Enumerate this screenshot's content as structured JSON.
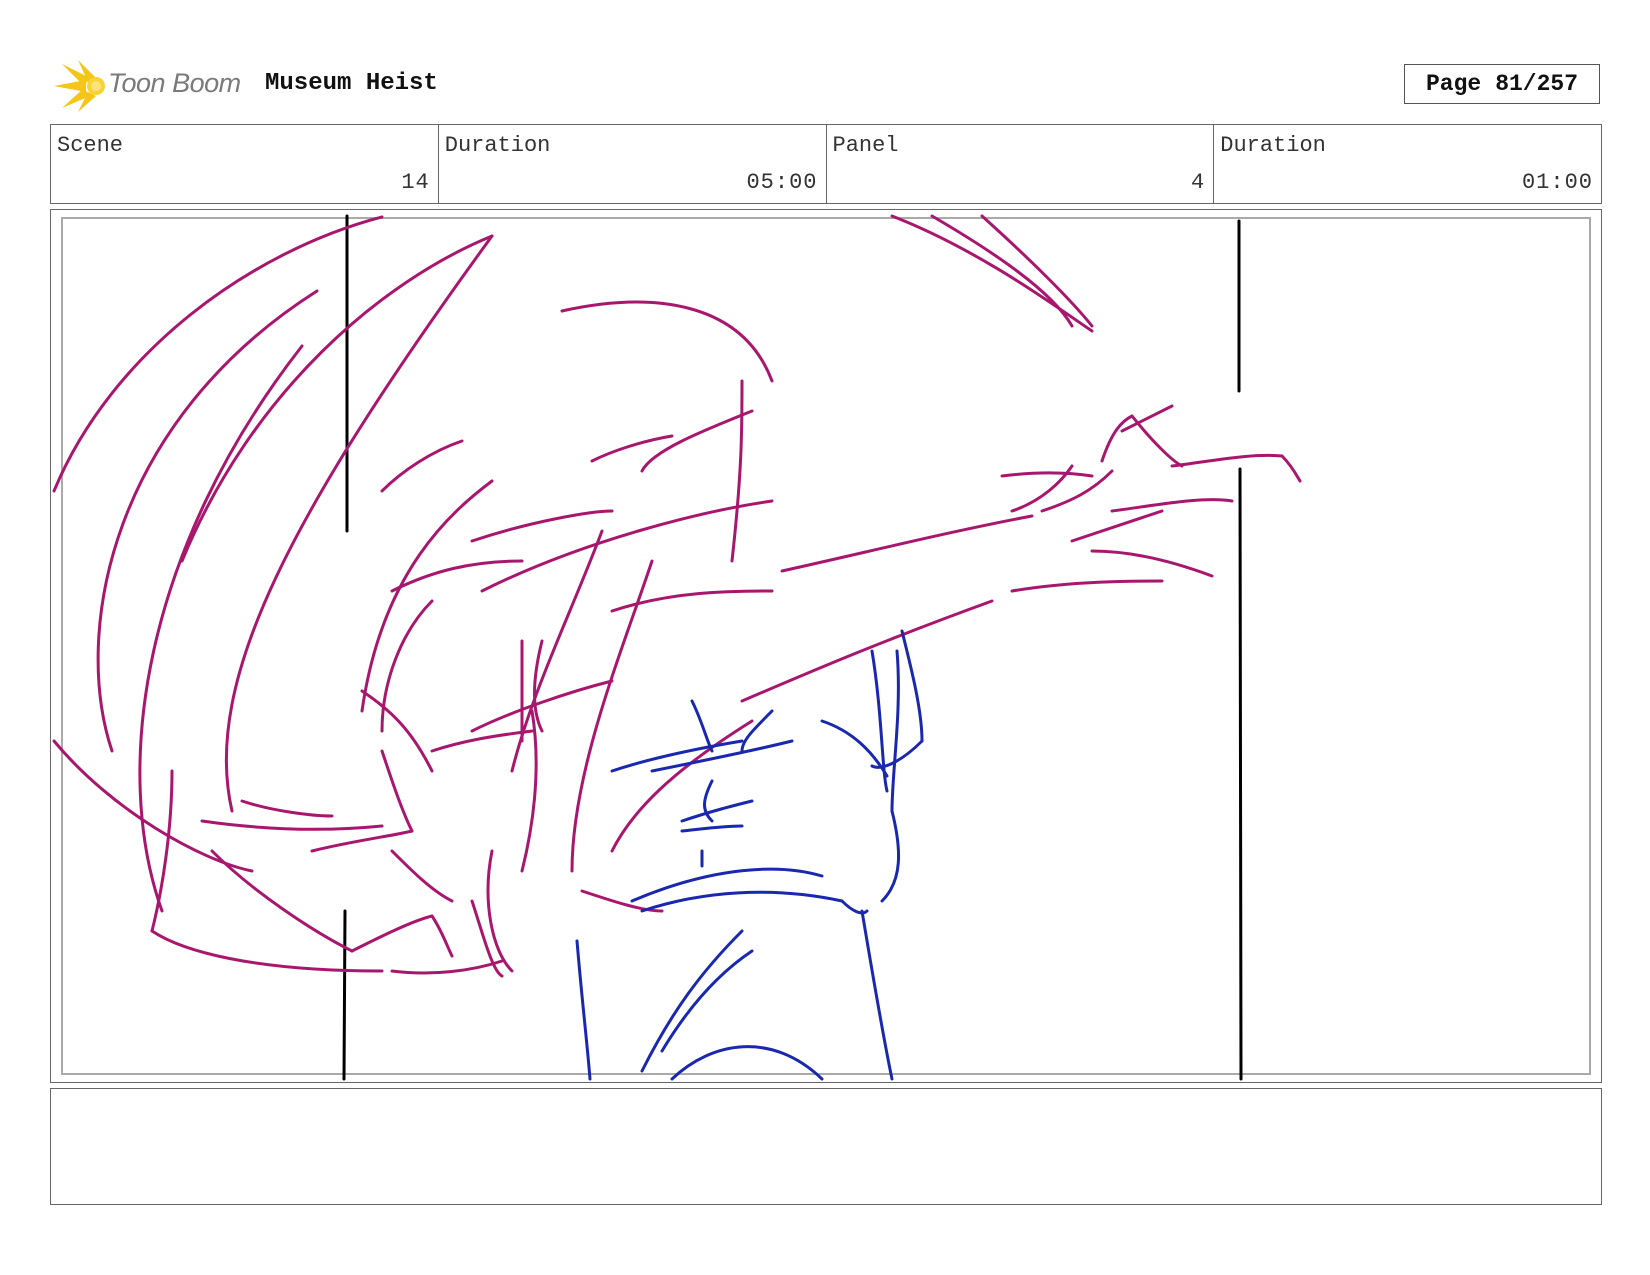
{
  "header": {
    "logo_text": "Toon Boom",
    "project_title": "Museum Heist",
    "page_label": "Page",
    "page_number": "81/257"
  },
  "info": {
    "scene_label": "Scene",
    "scene_value": "14",
    "scene_duration_label": "Duration",
    "scene_duration_value": "05:00",
    "panel_label": "Panel",
    "panel_value": "4",
    "panel_duration_label": "Duration",
    "panel_duration_value": "01:00"
  },
  "colors": {
    "character_sketch": "#a8176d",
    "clothing_sketch": "#1a28b0",
    "pillar_lines": "#000000",
    "logo_accent": "#f5c518"
  },
  "notes": {
    "text": ""
  }
}
